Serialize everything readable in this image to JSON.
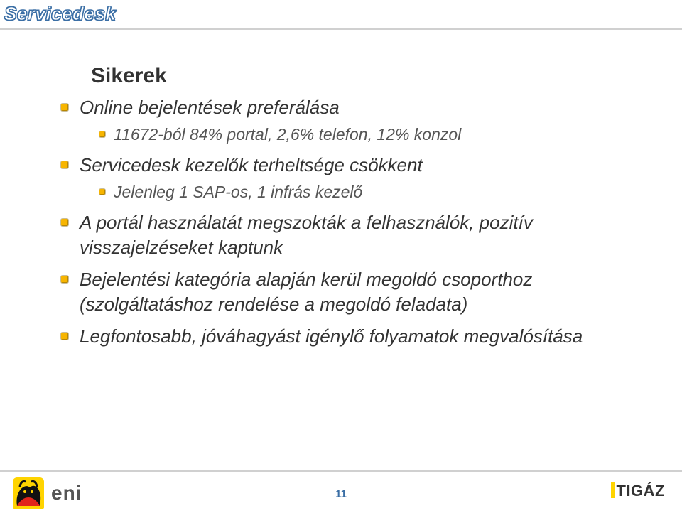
{
  "header": {
    "title": "Servicedesk"
  },
  "section_title": "Sikerek",
  "bullets": [
    {
      "text": "Online bejelentések preferálása",
      "sub": [
        "11672-ból 84% portal, 2,6% telefon, 12% konzol"
      ]
    },
    {
      "text": "Servicedesk kezelők terheltsége csökkent",
      "sub": [
        "Jelenleg 1 SAP-os, 1 infrás kezelő"
      ]
    },
    {
      "text": "A portál használatát megszokták a felhasználók, pozitív visszajelzéseket kaptunk"
    },
    {
      "text": "Bejelentési kategória alapján kerül megoldó csoporthoz (szolgáltatáshoz rendelése a megoldó feladata)"
    },
    {
      "text": "Legfontosabb, jóváhagyást igénylő folyamatok megvalósítása"
    }
  ],
  "footer": {
    "eni_brand": "eni",
    "page_number": "11",
    "tigaz_brand": "TIGÁZ"
  }
}
